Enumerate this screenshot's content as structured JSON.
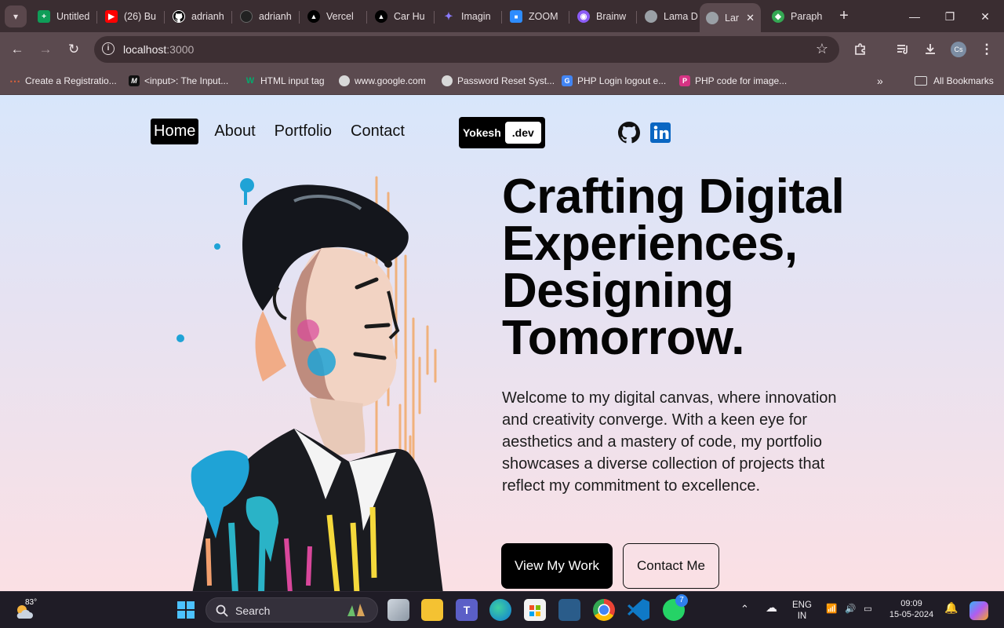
{
  "browser": {
    "tabs": [
      {
        "title": "Untitled",
        "icon": "sheets-icon",
        "color": "#0f9d58"
      },
      {
        "title": "(26) Bu",
        "icon": "youtube-icon",
        "color": "#ff0000"
      },
      {
        "title": "adrianh",
        "icon": "github-icon",
        "color": "#ffffff"
      },
      {
        "title": "adrianh",
        "icon": "github-icon",
        "color": "#222222"
      },
      {
        "title": "Vercel",
        "icon": "vercel-icon",
        "color": "#000000"
      },
      {
        "title": "Car Hu",
        "icon": "vercel-icon",
        "color": "#000000"
      },
      {
        "title": "Imagin",
        "icon": "sparkle-icon",
        "color": "#6b5cff"
      },
      {
        "title": "ZOOM",
        "icon": "zoom-icon",
        "color": "#2d8cff"
      },
      {
        "title": "Brainw",
        "icon": "brain-icon",
        "color": "#8b5cf6"
      },
      {
        "title": "Lama D",
        "icon": "globe-icon",
        "color": "#9aa0a6"
      },
      {
        "title": "Lar",
        "icon": "globe-icon",
        "color": "#9aa0a6"
      },
      {
        "title": "Paraph",
        "icon": "paraphrase-icon",
        "color": "#34a853"
      }
    ],
    "url_host": "localhost",
    "url_port": ":3000",
    "bookmarks": [
      {
        "label": "Create a Registratio...",
        "icon": "dots-icon",
        "color": "#e0623a"
      },
      {
        "label": "<input>: The Input...",
        "icon": "mdn-icon",
        "color": "#111111"
      },
      {
        "label": "HTML input tag",
        "icon": "w3-icon",
        "color": "#04aa6d"
      },
      {
        "label": "www.google.com",
        "icon": "globe-icon",
        "color": "#9aa0a6"
      },
      {
        "label": "Password Reset Syst...",
        "icon": "globe-icon",
        "color": "#9aa0a6"
      },
      {
        "label": "PHP Login logout e...",
        "icon": "g4g-icon",
        "color": "#4285f4"
      },
      {
        "label": "PHP code for image...",
        "icon": "p-icon",
        "color": "#d63384"
      }
    ],
    "all_bookmarks_label": "All Bookmarks",
    "profile_initials": "Cs"
  },
  "site": {
    "nav": [
      "Home",
      "About",
      "Portfolio",
      "Contact"
    ],
    "logo_name": "Yokesh",
    "logo_tld": ".dev",
    "headline": "Crafting Digital Experiences, Designing Tomorrow.",
    "description": "Welcome to my digital canvas, where innovation and creativity converge. With a keen eye for aesthetics and a mastery of code, my portfolio showcases a diverse collection of projects that reflect my commitment to excellence.",
    "primary_cta": "View My Work",
    "secondary_cta": "Contact Me"
  },
  "taskbar": {
    "temperature": "83°",
    "search_label": "Search",
    "language_line1": "ENG",
    "language_line2": "IN",
    "time": "09:09",
    "date": "15-05-2024",
    "whatsapp_badge": "7"
  }
}
